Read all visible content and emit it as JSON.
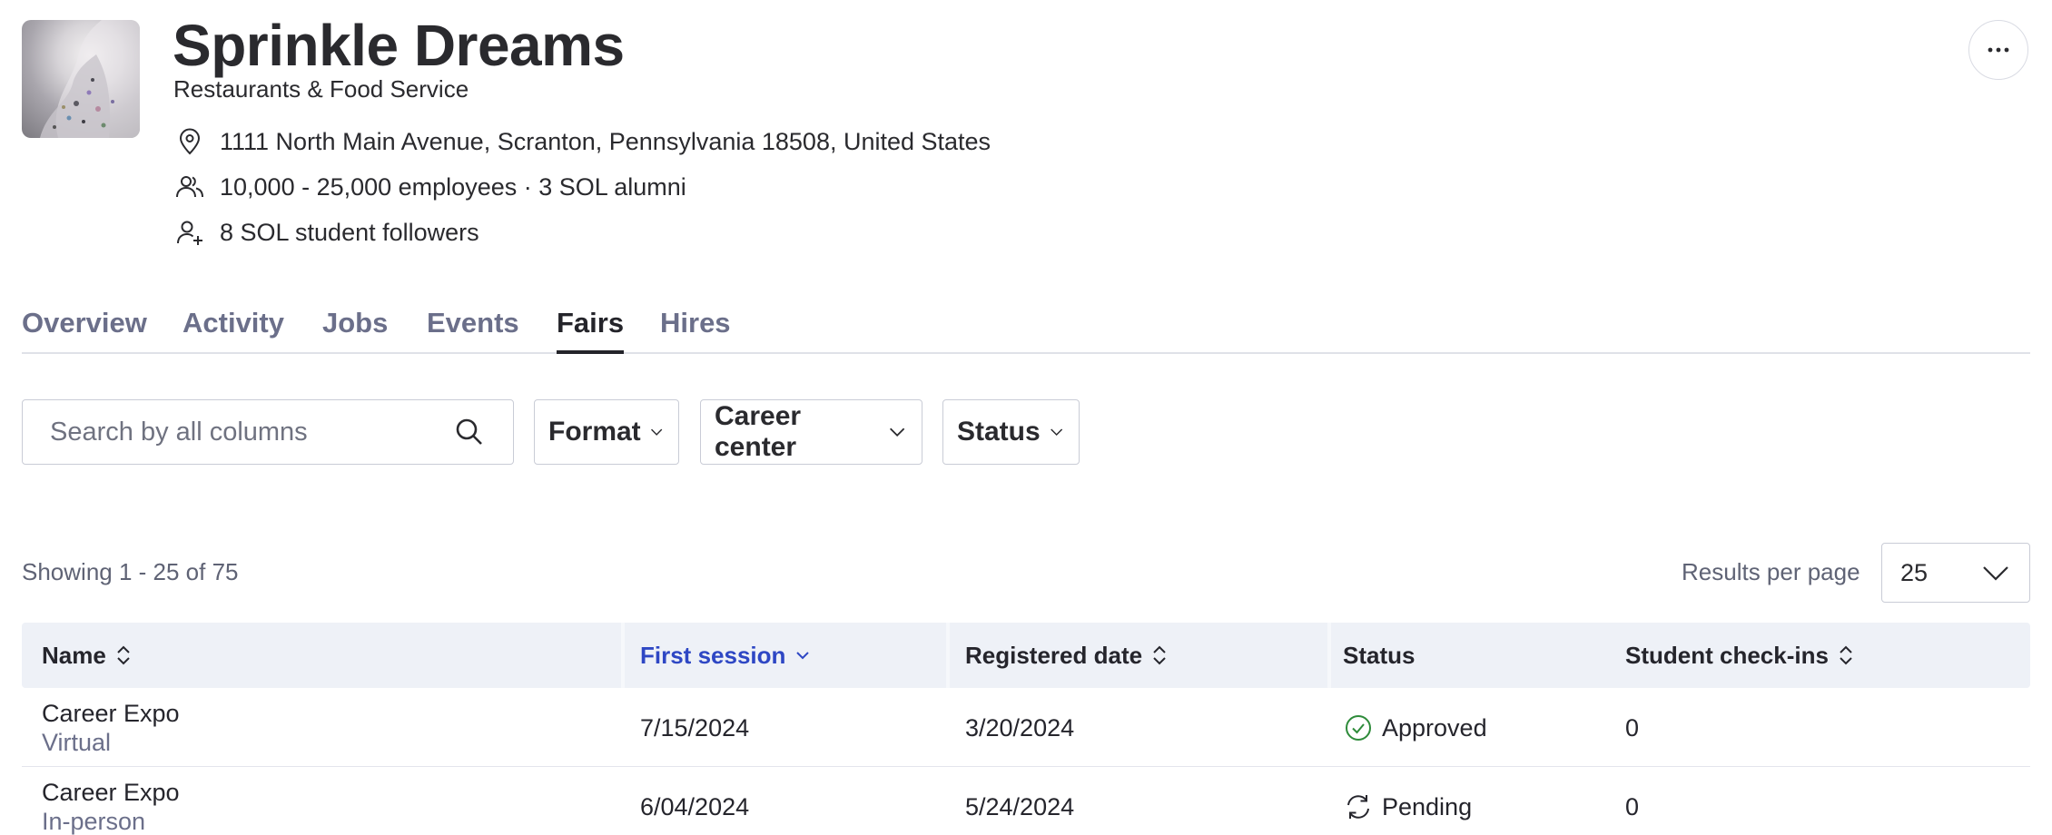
{
  "company": {
    "name": "Sprinkle Dreams",
    "industry": "Restaurants & Food Service",
    "address": "1111 North Main Avenue, Scranton, Pennsylvania 18508, United States",
    "employees": "10,000 - 25,000 employees · 3 SOL alumni",
    "followers": "8 SOL student followers",
    "icons": {
      "address": "location-pin-icon",
      "employees": "people-icon",
      "followers": "person-add-icon",
      "more": "more-horizontal-icon"
    }
  },
  "tabs": [
    {
      "label": "Overview",
      "active": false
    },
    {
      "label": "Activity",
      "active": false
    },
    {
      "label": "Jobs",
      "active": false
    },
    {
      "label": "Events",
      "active": false
    },
    {
      "label": "Fairs",
      "active": true
    },
    {
      "label": "Hires",
      "active": false
    }
  ],
  "filters": {
    "search_placeholder": "Search by all columns",
    "search_value": "",
    "format_label": "Format",
    "career_center_label": "Career center",
    "status_label": "Status"
  },
  "results": {
    "showing": "Showing 1 - 25 of 75",
    "per_page_label": "Results per page",
    "per_page_value": "25"
  },
  "table": {
    "columns": [
      {
        "label": "Name",
        "sort": "sortable"
      },
      {
        "label": "First session",
        "sort": "descending"
      },
      {
        "label": "Registered date",
        "sort": "sortable"
      },
      {
        "label": "Status",
        "sort": "none"
      },
      {
        "label": "Student check-ins",
        "sort": "sortable"
      }
    ],
    "rows": [
      {
        "name": "Career Expo",
        "format": "Virtual",
        "first_session": "7/15/2024",
        "registered": "3/20/2024",
        "status": "Approved",
        "status_icon": "check-circle-icon",
        "checkins": "0"
      },
      {
        "name": "Career Expo",
        "format": "In-person",
        "first_session": "6/04/2024",
        "registered": "5/24/2024",
        "status": "Pending",
        "status_icon": "refresh-icon",
        "checkins": "0"
      }
    ]
  },
  "colors": {
    "accent": "#2e47c4",
    "approved": "#2e8b3a",
    "muted_text": "#6b6f8a",
    "header_bg": "#eef1f7"
  }
}
